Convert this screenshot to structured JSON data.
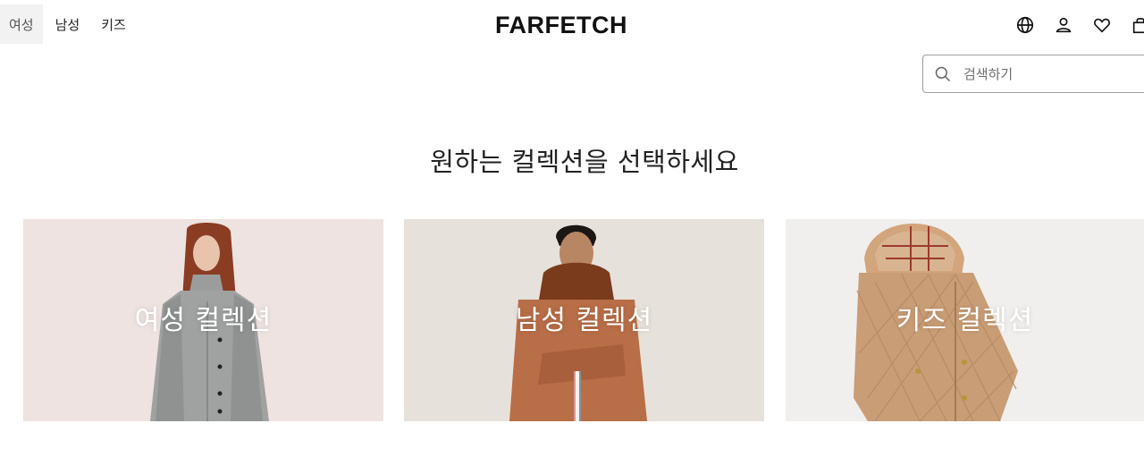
{
  "nav": {
    "tabs": [
      {
        "label": "여성",
        "active": true
      },
      {
        "label": "남성",
        "active": false
      },
      {
        "label": "키즈",
        "active": false
      }
    ]
  },
  "brand": {
    "logo_text": "FARFETCH"
  },
  "utility_icons": [
    "globe-icon",
    "user-icon",
    "heart-icon",
    "bag-icon"
  ],
  "search": {
    "placeholder": "검색하기",
    "value": ""
  },
  "main": {
    "heading": "원하는 컬렉션을 선택하세요",
    "collections": [
      {
        "label": "여성 컬렉션"
      },
      {
        "label": "남성 컬렉션"
      },
      {
        "label": "키즈 컬렉션"
      }
    ]
  }
}
